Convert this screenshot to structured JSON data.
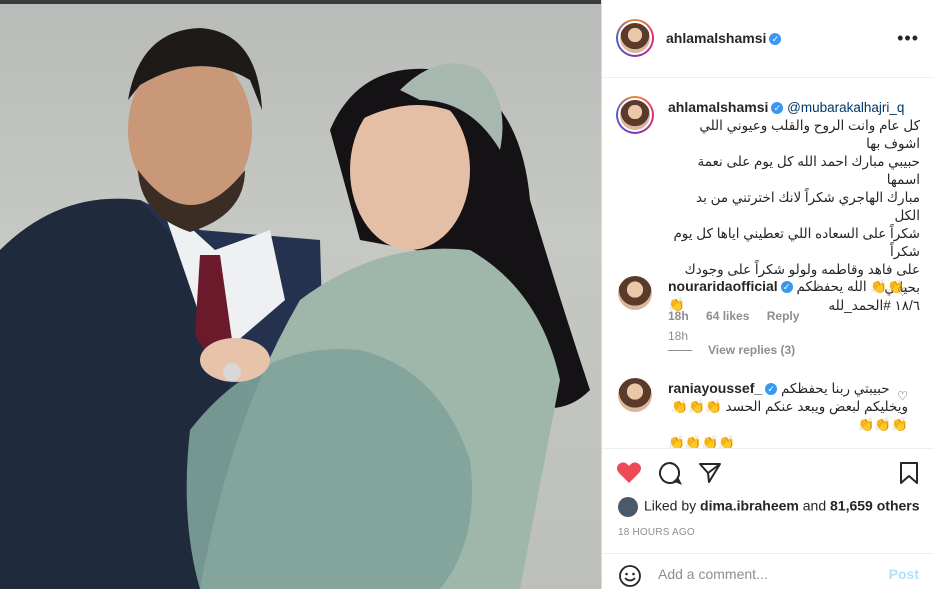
{
  "post": {
    "username": "ahlamalshamsi",
    "more_label": "•••",
    "caption": {
      "username": "ahlamalshamsi",
      "mention": "@mubarakalhajri_q",
      "lines": [
        "كل عام وانت الروح والقلب وعيوني اللي اشوف بها",
        "حبيبي مبارك احمد الله كل يوم على نعمة اسمها",
        "مبارك الهاجري شكراً لانك اخترتني من بد الكل",
        "شكراً على السعاده اللي تعطيني اياها كل يوم شكراً",
        "على فاهد وقاطمه ولولو شكراً على وجودك بحياتي"
      ],
      "hashtag_line": "١٨/٦ #الحمد_لله",
      "age": "18h"
    },
    "comments": [
      {
        "username": "nouraridaofficial",
        "text": "الله يحفظكم 👏👏👏",
        "age": "18h",
        "likes": "64 likes",
        "reply": "Reply",
        "view_replies": "View replies (3)"
      },
      {
        "username": "raniayoussef_",
        "text_line1": "حبيبتي ربنا يحفظكم",
        "text_line2": "ويخليكم لبعض ويبعد عنكم الحسد 👏👏👏👏👏👏",
        "text_line3": "👏👏👏👏"
      }
    ],
    "liked_by": {
      "prefix": "Liked by",
      "user": "dima.ibraheem",
      "and": "and",
      "others": "81,659 others"
    },
    "timestamp": "18 HOURS AGO",
    "add_comment_placeholder": "Add a comment...",
    "post_label": "Post"
  },
  "colors": {
    "heart": "#ed4956",
    "verified": "#3897f0",
    "link": "#00376b",
    "post_disabled": "#b2dffc"
  },
  "icons": [
    "heart-icon",
    "comment-icon",
    "share-icon",
    "bookmark-icon",
    "smile-icon",
    "verified-icon",
    "more-icon"
  ]
}
